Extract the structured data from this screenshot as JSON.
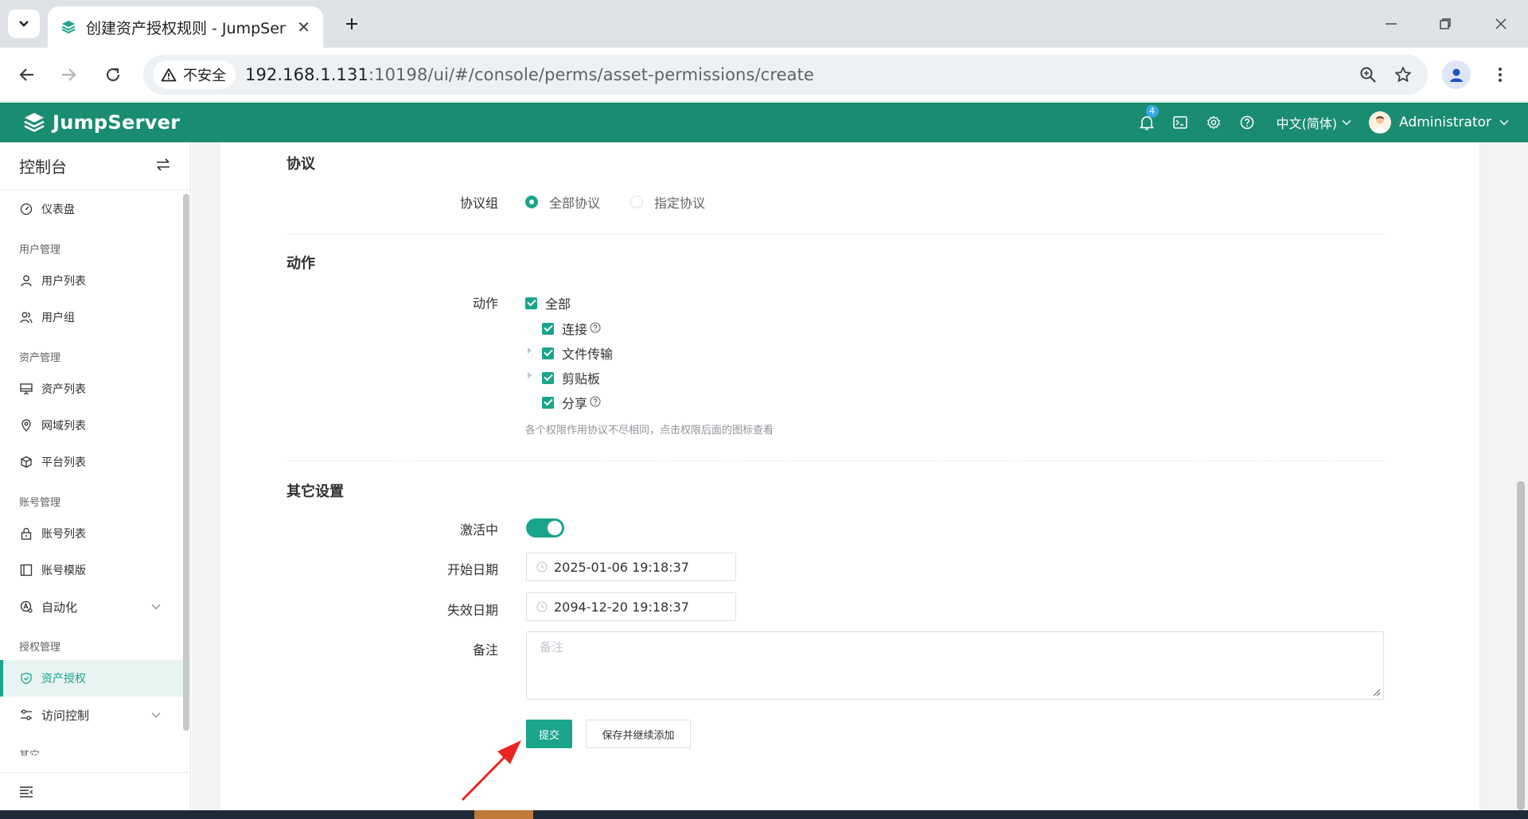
{
  "browser": {
    "tab_title": "创建资产授权规则 - JumpServer",
    "security_label": "不安全",
    "url_host": "192.168.1.131",
    "url_rest": ":10198/ui/#/console/perms/asset-permissions/create"
  },
  "header": {
    "brand": "JumpServer",
    "notification_count": "4",
    "language": "中文(简体)",
    "user_name": "Administrator"
  },
  "sidebar": {
    "title": "控制台",
    "dashboard": "仪表盘",
    "group_users": "用户管理",
    "user_list": "用户列表",
    "user_groups": "用户组",
    "group_assets": "资产管理",
    "asset_list": "资产列表",
    "zone_list": "网域列表",
    "platform_list": "平台列表",
    "group_accounts": "账号管理",
    "account_list": "账号列表",
    "account_template": "账号模版",
    "automation": "自动化",
    "group_perms": "授权管理",
    "asset_perms": "资产授权",
    "access_control": "访问控制",
    "group_other": "其它"
  },
  "form": {
    "protocol_section": "协议",
    "protocol_group_label": "协议组",
    "protocol_all": "全部协议",
    "protocol_specific": "指定协议",
    "protocol_selected": "全部协议",
    "actions_section": "动作",
    "actions_label": "动作",
    "action_all": "全部",
    "action_connect": "连接",
    "action_transfer": "文件传输",
    "action_clipboard": "剪贴板",
    "action_share": "分享",
    "actions_hint": "各个权限作用协议不尽相同，点击权限后面的图标查看",
    "other_section": "其它设置",
    "active_label": "激活中",
    "active_value": true,
    "start_label": "开始日期",
    "start_value": "2025-01-06 19:18:37",
    "end_label": "失效日期",
    "end_value": "2094-12-20 19:18:37",
    "comment_label": "备注",
    "comment_placeholder": "备注",
    "submit": "提交",
    "save_continue": "保存并继续添加"
  },
  "colors": {
    "brand": "#1a8c71",
    "accent": "#1aa58a",
    "annotation_arrow": "#e8261e"
  }
}
